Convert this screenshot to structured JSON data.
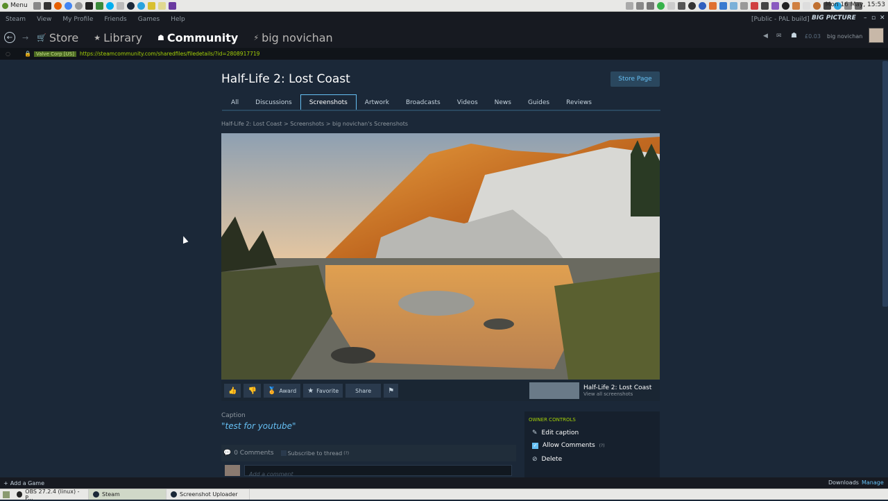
{
  "os_panel": {
    "menu_label": "Menu",
    "clock": "Mon 16 May, 15:53"
  },
  "steam_menu": {
    "items": [
      "Steam",
      "View",
      "My Profile",
      "Friends",
      "Games",
      "Help"
    ],
    "build": "[Public - PAL build]",
    "big_picture": "BIG PICTURE"
  },
  "nav": {
    "tabs": [
      "Store",
      "Library",
      "Community",
      "big novichan"
    ],
    "balance": "£0.03",
    "user": "big novichan"
  },
  "url_bar": {
    "cert": "Valve Corp [US]",
    "url": "https://steamcommunity.com/sharedfiles/filedetails/?id=2808917719"
  },
  "page": {
    "title": "Half-Life 2: Lost Coast",
    "store_button": "Store Page",
    "tabs": [
      "All",
      "Discussions",
      "Screenshots",
      "Artwork",
      "Broadcasts",
      "Videos",
      "News",
      "Guides",
      "Reviews"
    ],
    "breadcrumb": "Half-Life 2: Lost Coast > Screenshots > big novichan's Screenshots"
  },
  "actions": {
    "award": "Award",
    "favorite": "Favorite",
    "share": "Share"
  },
  "game_card": {
    "title": "Half-Life 2: Lost Coast",
    "sub": "View all screenshots"
  },
  "caption": {
    "label": "Caption",
    "text": "\"test for youtube\""
  },
  "comments": {
    "count": "0 Comments",
    "subscribe": "Subscribe to thread",
    "placeholder": "Add a comment"
  },
  "owner_controls": {
    "header": "OWNER CONTROLS",
    "edit": "Edit caption",
    "allow": "Allow Comments",
    "delete": "Delete"
  },
  "bottom": {
    "add_game": "Add a Game",
    "downloads": "Downloads",
    "manage": "Manage"
  },
  "taskbar": {
    "items": [
      "OBS 27.2.4 (linux) - P...",
      "Steam",
      "Screenshot Uploader"
    ]
  },
  "colors": {
    "accent": "#66c0f4",
    "bg": "#1b2838",
    "green": "#a4d007"
  }
}
